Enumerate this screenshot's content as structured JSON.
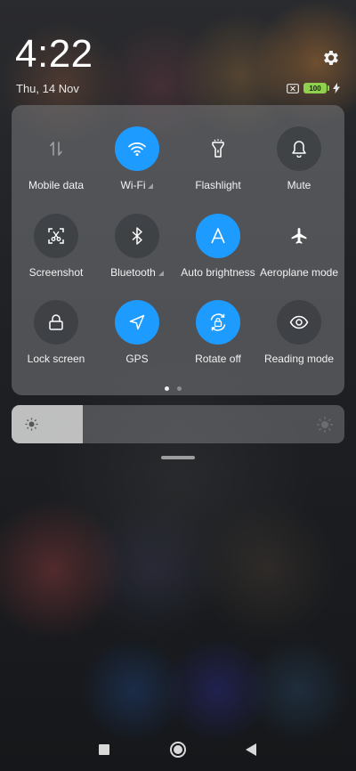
{
  "status_bar": {
    "time": "4:22",
    "date": "Thu, 14 Nov",
    "battery_level": "100",
    "charging": true
  },
  "quick_settings": {
    "tiles": [
      {
        "label": "Mobile data",
        "icon": "mobile-data-icon",
        "active": false,
        "signal": false
      },
      {
        "label": "Wi-Fi",
        "icon": "wifi-icon",
        "active": true,
        "signal": true
      },
      {
        "label": "Flashlight",
        "icon": "flashlight-icon",
        "active": false,
        "signal": false
      },
      {
        "label": "Mute",
        "icon": "bell-icon",
        "active": false,
        "signal": false
      },
      {
        "label": "Screenshot",
        "icon": "screenshot-icon",
        "active": false,
        "signal": false
      },
      {
        "label": "Bluetooth",
        "icon": "bluetooth-icon",
        "active": false,
        "signal": true
      },
      {
        "label": "Auto brightness",
        "icon": "auto-brightness-icon",
        "active": true,
        "signal": false
      },
      {
        "label": "Aeroplane mode",
        "icon": "airplane-icon",
        "active": false,
        "signal": false
      },
      {
        "label": "Lock screen",
        "icon": "lock-icon",
        "active": false,
        "signal": false
      },
      {
        "label": "GPS",
        "icon": "location-arrow-icon",
        "active": true,
        "signal": false
      },
      {
        "label": "Rotate off",
        "icon": "rotation-lock-icon",
        "active": true,
        "signal": false
      },
      {
        "label": "Reading mode",
        "icon": "eye-icon",
        "active": false,
        "signal": false
      }
    ],
    "page_count": 2,
    "current_page": 1
  },
  "brightness": {
    "level_percent": 21.5
  },
  "colors": {
    "accent": "#1e9bff",
    "battery": "#8fd14f"
  }
}
